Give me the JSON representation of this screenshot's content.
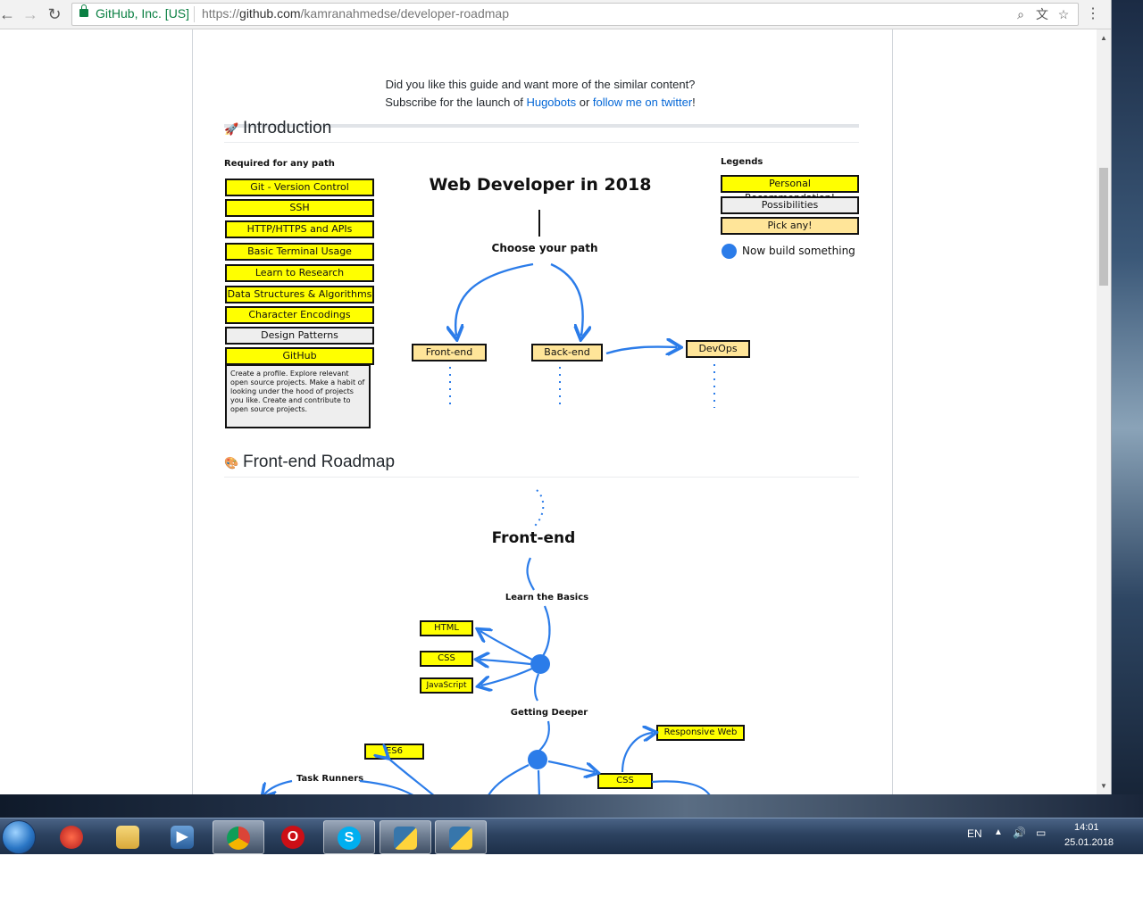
{
  "browser": {
    "org": "GitHub, Inc. [US]",
    "url_prefix": "https://",
    "url_host": "github.com",
    "url_path": "/kamranahmedse/developer-roadmap"
  },
  "page": {
    "line1": "Did you like this guide and want more of the similar content?",
    "line2_a": "Subscribe for the launch of ",
    "link1": "Hugobots",
    "line2_b": " or ",
    "link2": "follow me on twitter",
    "line2_c": "!",
    "intro_heading": "Introduction",
    "frontend_heading": "Front-end Roadmap",
    "intro_icon": "rocket-icon",
    "frontend_icon": "palette-icon"
  },
  "intro": {
    "required_title": "Required for any path",
    "required_items": [
      {
        "label": "Git - Version Control",
        "style": "yellow"
      },
      {
        "label": "SSH",
        "style": "yellow"
      },
      {
        "label": "HTTP/HTTPS and APIs",
        "style": "yellow"
      },
      {
        "label": "Basic Terminal Usage",
        "style": "yellow"
      },
      {
        "label": "Learn to Research",
        "style": "yellow"
      },
      {
        "label": "Data Structures & Algorithms",
        "style": "yellow"
      },
      {
        "label": "Character Encodings",
        "style": "yellow"
      },
      {
        "label": "Design Patterns",
        "style": "grey"
      },
      {
        "label": "GitHub",
        "style": "yellow"
      }
    ],
    "github_desc": "Create a profile. Explore relevant open source projects. Make a habit of looking under the hood of projects you like. Create and contribute to open source projects.",
    "diagram_title": "Web Developer in 2018",
    "choose": "Choose your path",
    "paths": [
      "Front-end",
      "Back-end",
      "DevOps"
    ],
    "legends_title": "Legends",
    "legends": [
      {
        "label": "Personal Recommendation!",
        "style": "yellow"
      },
      {
        "label": "Possibilities",
        "style": "grey"
      },
      {
        "label": "Pick any!",
        "style": "orange"
      }
    ],
    "build": "Now build something"
  },
  "frontend": {
    "title": "Front-end",
    "learn_basics": "Learn the Basics",
    "basics": [
      "HTML",
      "CSS",
      "JavaScript"
    ],
    "getting_deeper": "Getting Deeper",
    "es6": "ES6",
    "task_runners": "Task Runners",
    "css": "CSS",
    "responsive": "Responsive Web"
  },
  "taskbar": {
    "lang": "EN",
    "time": "14:01",
    "date": "25.01.2018"
  },
  "colors": {
    "sketch_yellow": "#ffff00",
    "sketch_orange": "#ffe599",
    "sketch_grey": "#eeeeee",
    "arrow_blue": "#2b7ce9",
    "link_blue": "#0366d6"
  }
}
